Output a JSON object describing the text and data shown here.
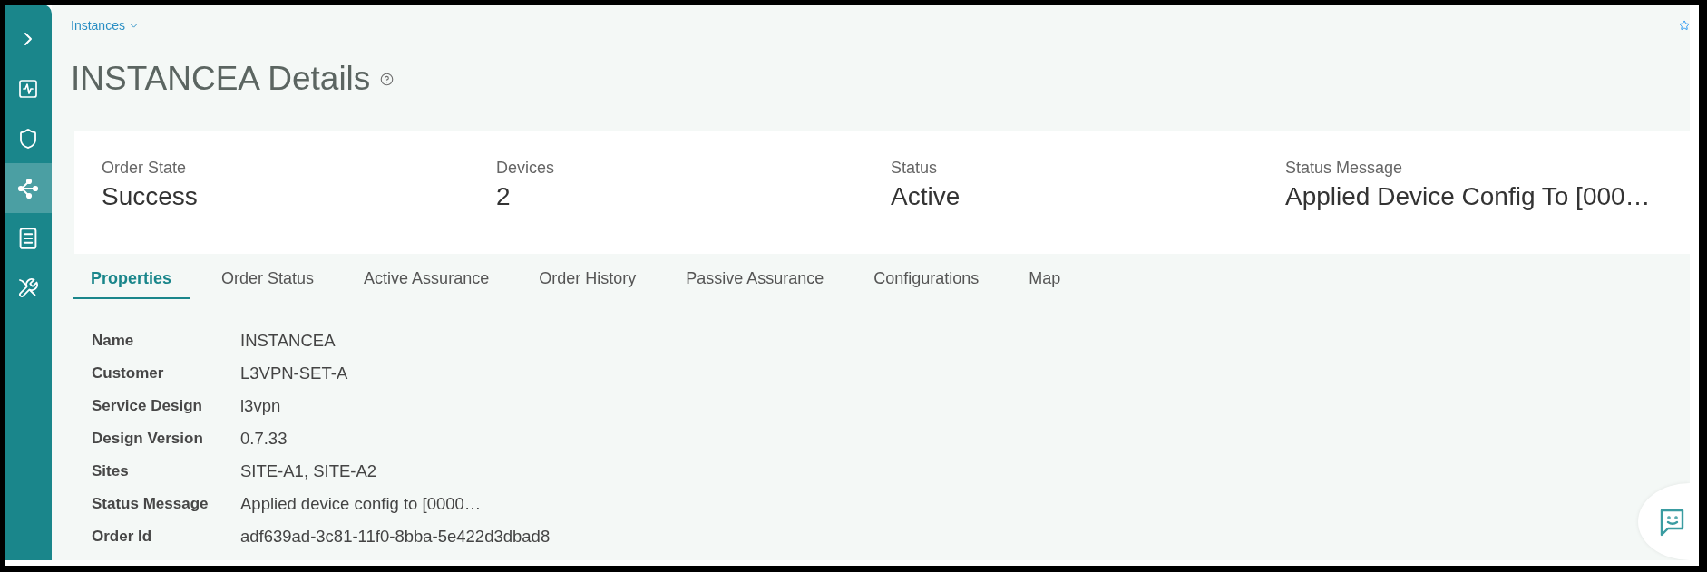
{
  "sidebar": {
    "items": [
      {
        "selected": false
      },
      {
        "selected": false
      },
      {
        "selected": true
      },
      {
        "selected": false
      },
      {
        "selected": false
      }
    ]
  },
  "breadcrumb": {
    "label": "Instances"
  },
  "page": {
    "title": "INSTANCEA Details"
  },
  "summary": [
    {
      "label": "Order State",
      "value": "Success"
    },
    {
      "label": "Devices",
      "value": "2"
    },
    {
      "label": "Status",
      "value": "Active"
    },
    {
      "label": "Status Message",
      "value": "Applied Device Config To [000…"
    }
  ],
  "tabs": [
    {
      "label": "Properties",
      "selected": true
    },
    {
      "label": "Order Status",
      "selected": false
    },
    {
      "label": "Active Assurance",
      "selected": false
    },
    {
      "label": "Order History",
      "selected": false
    },
    {
      "label": "Passive Assurance",
      "selected": false
    },
    {
      "label": "Configurations",
      "selected": false
    },
    {
      "label": "Map",
      "selected": false
    }
  ],
  "properties": [
    {
      "label": "Name",
      "value": "INSTANCEA"
    },
    {
      "label": "Customer",
      "value": "L3VPN-SET-A"
    },
    {
      "label": "Service Design",
      "value": "l3vpn"
    },
    {
      "label": "Design Version",
      "value": "0.7.33"
    },
    {
      "label": "Sites",
      "value": "SITE-A1, SITE-A2"
    },
    {
      "label": "Status Message",
      "value": "Applied device config to [0000…"
    },
    {
      "label": "Order Id",
      "value": "adf639ad-3c81-11f0-8bba-5e422d3dbad8"
    }
  ]
}
